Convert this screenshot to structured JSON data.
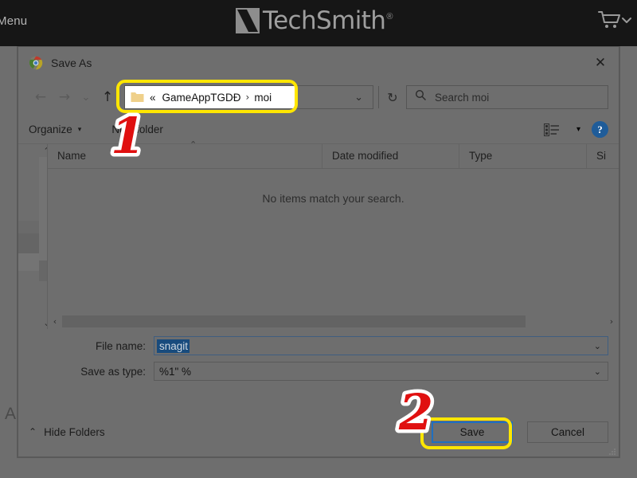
{
  "background_page": {
    "menu_label": "Menu",
    "brand": "TechSmith",
    "brand_registered": "®",
    "cart_icon": "shopping-cart-icon",
    "stray_text": "A"
  },
  "dialog": {
    "title": "Save As",
    "app_icon": "chrome-icon",
    "close_label": "✕",
    "navigation": {
      "back": "←",
      "forward": "→",
      "recent": "⌄",
      "up": "↑"
    },
    "address_bar": {
      "folder_icon": "folder-icon",
      "overflow": "«",
      "segments": [
        "GameAppTGDĐ",
        "moi"
      ],
      "separator": "›",
      "dropdown_caret": "⌄",
      "refresh": "↻"
    },
    "search": {
      "icon": "search-icon",
      "placeholder": "Search moi"
    },
    "toolbar": {
      "organize_label": "Organize",
      "organize_caret": "▾",
      "new_folder_label": "New folder",
      "view_icon": "list-view-icon",
      "view_caret": "▾",
      "help_label": "?"
    },
    "columns": {
      "name": "Name",
      "date_modified": "Date modified",
      "type": "Type",
      "size": "Si",
      "sort_caret": "⌃"
    },
    "empty_message": "No items match your search.",
    "scrollbars": {
      "v_up": "⌃",
      "v_down": "⌄",
      "h_left": "‹",
      "h_right": "›"
    },
    "form": {
      "file_name_label": "File name:",
      "file_name_value": "snagit",
      "save_as_type_label": "Save as type:",
      "save_as_type_value": "%1\" %",
      "combo_caret": "⌄"
    },
    "footer": {
      "hide_folders_caret": "⌃",
      "hide_folders_label": "Hide Folders",
      "save_label": "Save",
      "cancel_label": "Cancel"
    }
  },
  "annotations": {
    "marker_1": "1",
    "marker_2": "2",
    "highlight_color": "#ffe600",
    "marker_color": "#e01010",
    "marker_outline_color": "#ffffff"
  }
}
